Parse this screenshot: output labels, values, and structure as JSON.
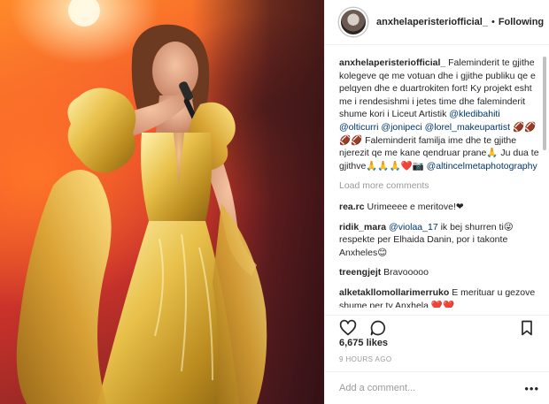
{
  "header": {
    "username": "anxhelaperisteriofficial_",
    "separator": "•",
    "follow_label": "Following"
  },
  "caption": {
    "username": "anxhelaperisteriofficial_",
    "text_1": " Faleminderit te gjithe kolegeve qe me votuan dhe i gjithe publiku qe e pelqyen dhe e duartrokiten fort! Ky projekt esht me i rendesishmi i jetes time dhe faleminderit shume kori i Liceut Artistik ",
    "mention_1": "@kledibahiti",
    "mention_2": "@olticurri",
    "mention_3": "@jonipeci",
    "mention_4": "@lorel_makeupartist",
    "emoji_1": " 🏈🏈🏈🏈",
    "text_2": " Faleminderit familja ime dhe te gjithe njerezit qe me kane qendruar prane🙏 Ju dua te gjithve🙏🙏🙏❤️📷 ",
    "mention_5": "@altincelmetaphotography"
  },
  "load_more": "Load more comments",
  "comments": [
    {
      "user": "rea.rc",
      "text": " Urimeeee e meritove!❤"
    },
    {
      "user": "ridik_mara",
      "mention": "@violaa_17",
      "text": " ik bej shurren ti😜 respekte per Elhaida Danin, por i takonte Anxheles😊"
    },
    {
      "user": "treengjejt",
      "text": " Bravooooo"
    },
    {
      "user": "alketakllomollarimerruko",
      "text": " E merituar u gezove shume per ty Anxhela ❤️❤️"
    }
  ],
  "likes": "6,675 likes",
  "timestamp": "9 HOURS AGO",
  "add_comment": {
    "placeholder": "Add a comment...",
    "more": "•••"
  },
  "colors": {
    "mention": "#003569",
    "muted": "#999999",
    "border": "#efefef"
  },
  "icons": [
    "heart-icon",
    "comment-icon",
    "bookmark-icon",
    "more-options-icon"
  ]
}
